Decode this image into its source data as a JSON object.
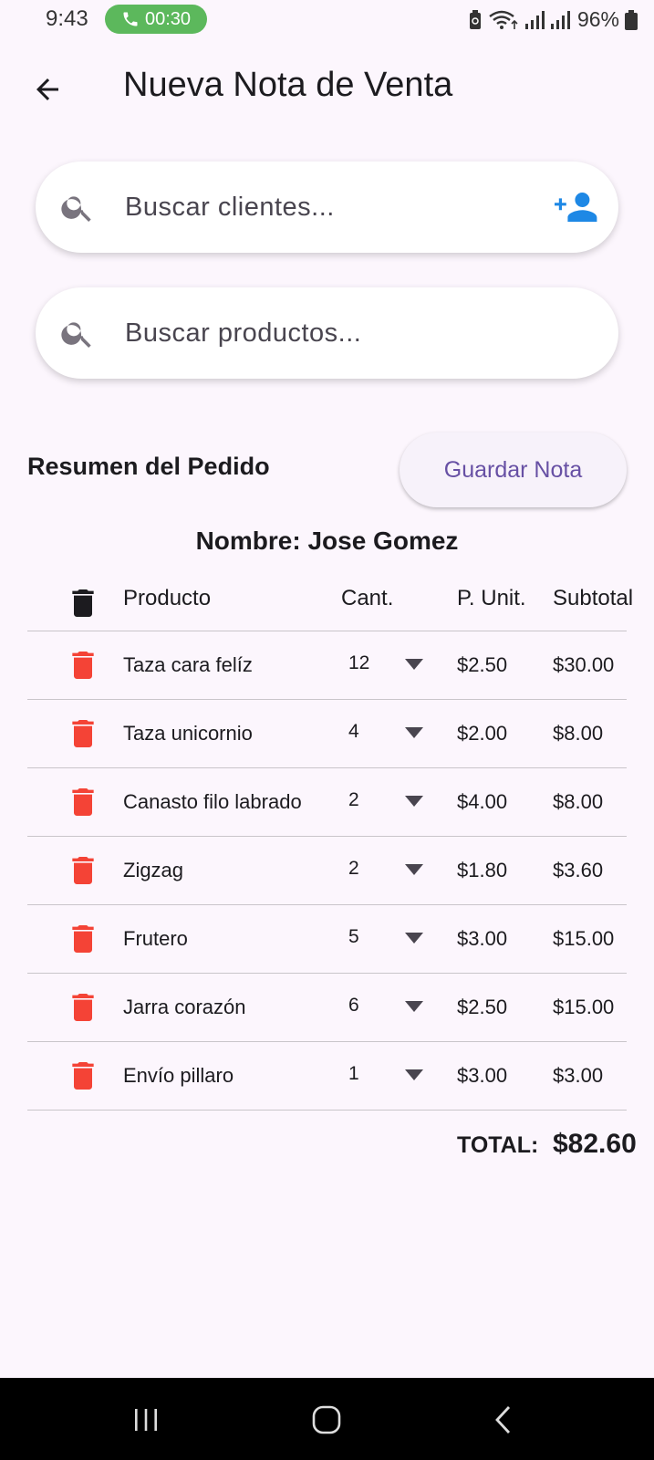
{
  "status_bar": {
    "time": "9:43",
    "call_timer": "00:30",
    "battery": "96%",
    "call_color": "#5cb85c"
  },
  "app_bar": {
    "title": "Nueva Nota de Venta",
    "back_icon": "arrow-left-icon"
  },
  "client_search": {
    "placeholder": "Buscar clientes...",
    "value": "",
    "action_icon": "add-person-icon",
    "action_color": "#1e88e5"
  },
  "product_search": {
    "placeholder": "Buscar productos...",
    "value": ""
  },
  "summary": {
    "title": "Resumen del Pedido",
    "save_label": "Guardar Nota",
    "customer_label": "Nombre: Jose Gomez"
  },
  "table": {
    "headers": {
      "product": "Producto",
      "qty": "Cant.",
      "unit_price": "P. Unit.",
      "subtotal": "Subtotal"
    },
    "rows": [
      {
        "product": "Taza cara felíz",
        "qty": "12",
        "unit_price": "$2.50",
        "subtotal": "$30.00"
      },
      {
        "product": "Taza unicornio",
        "qty": "4",
        "unit_price": "$2.00",
        "subtotal": "$8.00"
      },
      {
        "product": "Canasto filo labrado",
        "qty": "2",
        "unit_price": "$4.00",
        "subtotal": "$8.00"
      },
      {
        "product": "Zigzag",
        "qty": "2",
        "unit_price": "$1.80",
        "subtotal": "$3.60"
      },
      {
        "product": "Frutero",
        "qty": "5",
        "unit_price": "$3.00",
        "subtotal": "$15.00"
      },
      {
        "product": "Jarra corazón",
        "qty": "6",
        "unit_price": "$2.50",
        "subtotal": "$15.00"
      },
      {
        "product": "Envío pillaro",
        "qty": "1",
        "unit_price": "$3.00",
        "subtotal": "$3.00"
      }
    ],
    "delete_color": "#f44336"
  },
  "total": {
    "label": "TOTAL:",
    "value": "$82.60"
  },
  "colors": {
    "background": "#fcf6fd",
    "accent": "#6750a4"
  }
}
